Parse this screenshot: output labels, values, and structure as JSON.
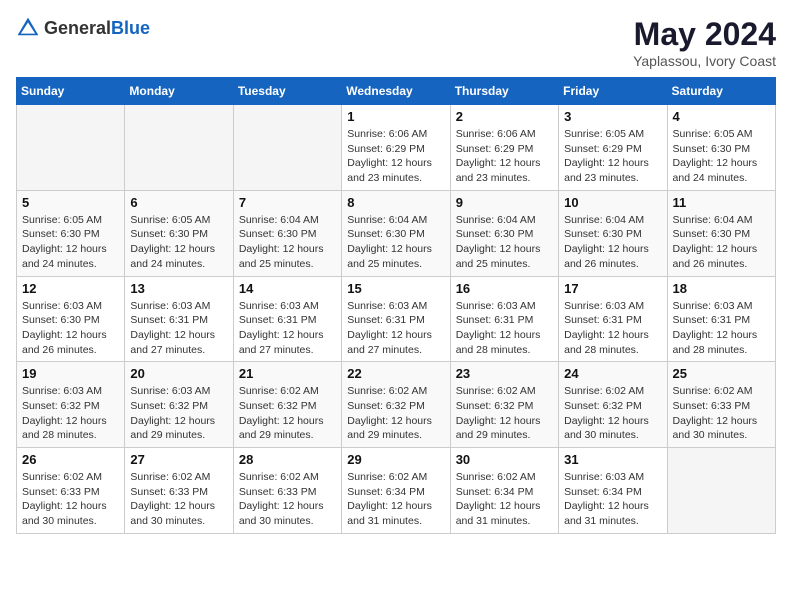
{
  "header": {
    "logo_general": "General",
    "logo_blue": "Blue",
    "title": "May 2024",
    "subtitle": "Yaplassou, Ivory Coast"
  },
  "days_of_week": [
    "Sunday",
    "Monday",
    "Tuesday",
    "Wednesday",
    "Thursday",
    "Friday",
    "Saturday"
  ],
  "weeks": [
    [
      {
        "day": "",
        "info": ""
      },
      {
        "day": "",
        "info": ""
      },
      {
        "day": "",
        "info": ""
      },
      {
        "day": "1",
        "info": "Sunrise: 6:06 AM\nSunset: 6:29 PM\nDaylight: 12 hours\nand 23 minutes."
      },
      {
        "day": "2",
        "info": "Sunrise: 6:06 AM\nSunset: 6:29 PM\nDaylight: 12 hours\nand 23 minutes."
      },
      {
        "day": "3",
        "info": "Sunrise: 6:05 AM\nSunset: 6:29 PM\nDaylight: 12 hours\nand 23 minutes."
      },
      {
        "day": "4",
        "info": "Sunrise: 6:05 AM\nSunset: 6:30 PM\nDaylight: 12 hours\nand 24 minutes."
      }
    ],
    [
      {
        "day": "5",
        "info": "Sunrise: 6:05 AM\nSunset: 6:30 PM\nDaylight: 12 hours\nand 24 minutes."
      },
      {
        "day": "6",
        "info": "Sunrise: 6:05 AM\nSunset: 6:30 PM\nDaylight: 12 hours\nand 24 minutes."
      },
      {
        "day": "7",
        "info": "Sunrise: 6:04 AM\nSunset: 6:30 PM\nDaylight: 12 hours\nand 25 minutes."
      },
      {
        "day": "8",
        "info": "Sunrise: 6:04 AM\nSunset: 6:30 PM\nDaylight: 12 hours\nand 25 minutes."
      },
      {
        "day": "9",
        "info": "Sunrise: 6:04 AM\nSunset: 6:30 PM\nDaylight: 12 hours\nand 25 minutes."
      },
      {
        "day": "10",
        "info": "Sunrise: 6:04 AM\nSunset: 6:30 PM\nDaylight: 12 hours\nand 26 minutes."
      },
      {
        "day": "11",
        "info": "Sunrise: 6:04 AM\nSunset: 6:30 PM\nDaylight: 12 hours\nand 26 minutes."
      }
    ],
    [
      {
        "day": "12",
        "info": "Sunrise: 6:03 AM\nSunset: 6:30 PM\nDaylight: 12 hours\nand 26 minutes."
      },
      {
        "day": "13",
        "info": "Sunrise: 6:03 AM\nSunset: 6:31 PM\nDaylight: 12 hours\nand 27 minutes."
      },
      {
        "day": "14",
        "info": "Sunrise: 6:03 AM\nSunset: 6:31 PM\nDaylight: 12 hours\nand 27 minutes."
      },
      {
        "day": "15",
        "info": "Sunrise: 6:03 AM\nSunset: 6:31 PM\nDaylight: 12 hours\nand 27 minutes."
      },
      {
        "day": "16",
        "info": "Sunrise: 6:03 AM\nSunset: 6:31 PM\nDaylight: 12 hours\nand 28 minutes."
      },
      {
        "day": "17",
        "info": "Sunrise: 6:03 AM\nSunset: 6:31 PM\nDaylight: 12 hours\nand 28 minutes."
      },
      {
        "day": "18",
        "info": "Sunrise: 6:03 AM\nSunset: 6:31 PM\nDaylight: 12 hours\nand 28 minutes."
      }
    ],
    [
      {
        "day": "19",
        "info": "Sunrise: 6:03 AM\nSunset: 6:32 PM\nDaylight: 12 hours\nand 28 minutes."
      },
      {
        "day": "20",
        "info": "Sunrise: 6:03 AM\nSunset: 6:32 PM\nDaylight: 12 hours\nand 29 minutes."
      },
      {
        "day": "21",
        "info": "Sunrise: 6:02 AM\nSunset: 6:32 PM\nDaylight: 12 hours\nand 29 minutes."
      },
      {
        "day": "22",
        "info": "Sunrise: 6:02 AM\nSunset: 6:32 PM\nDaylight: 12 hours\nand 29 minutes."
      },
      {
        "day": "23",
        "info": "Sunrise: 6:02 AM\nSunset: 6:32 PM\nDaylight: 12 hours\nand 29 minutes."
      },
      {
        "day": "24",
        "info": "Sunrise: 6:02 AM\nSunset: 6:32 PM\nDaylight: 12 hours\nand 30 minutes."
      },
      {
        "day": "25",
        "info": "Sunrise: 6:02 AM\nSunset: 6:33 PM\nDaylight: 12 hours\nand 30 minutes."
      }
    ],
    [
      {
        "day": "26",
        "info": "Sunrise: 6:02 AM\nSunset: 6:33 PM\nDaylight: 12 hours\nand 30 minutes."
      },
      {
        "day": "27",
        "info": "Sunrise: 6:02 AM\nSunset: 6:33 PM\nDaylight: 12 hours\nand 30 minutes."
      },
      {
        "day": "28",
        "info": "Sunrise: 6:02 AM\nSunset: 6:33 PM\nDaylight: 12 hours\nand 30 minutes."
      },
      {
        "day": "29",
        "info": "Sunrise: 6:02 AM\nSunset: 6:34 PM\nDaylight: 12 hours\nand 31 minutes."
      },
      {
        "day": "30",
        "info": "Sunrise: 6:02 AM\nSunset: 6:34 PM\nDaylight: 12 hours\nand 31 minutes."
      },
      {
        "day": "31",
        "info": "Sunrise: 6:03 AM\nSunset: 6:34 PM\nDaylight: 12 hours\nand 31 minutes."
      },
      {
        "day": "",
        "info": ""
      }
    ]
  ]
}
